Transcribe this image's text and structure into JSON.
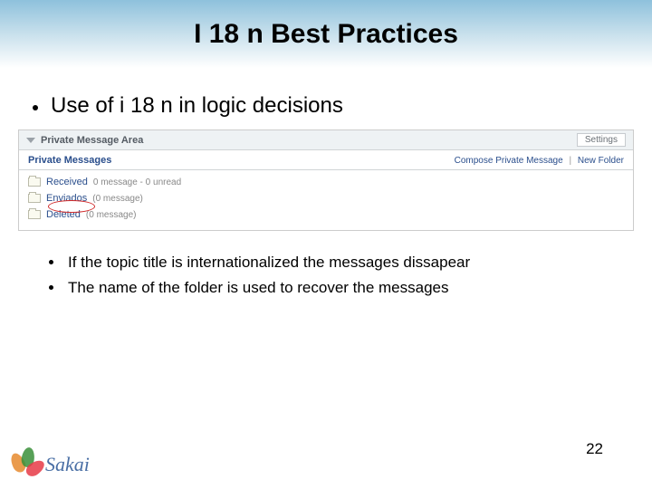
{
  "slide": {
    "title": "I 18 n Best Practices",
    "main_bullet": "Use of i 18 n in logic decisions",
    "sub_bullets": [
      "If the topic title is internationalized the messages dissapear",
      "The name of the folder is used to recover the messages"
    ],
    "page_number": "22"
  },
  "panel": {
    "area_title": "Private Message Area",
    "settings_label": "Settings",
    "section_title": "Private Messages",
    "compose_label": "Compose Private Message",
    "new_folder_label": "New Folder",
    "folders": [
      {
        "name": "Received",
        "meta": "0 message - 0 unread"
      },
      {
        "name": "Enviados",
        "meta": "(0 message)"
      },
      {
        "name": "Deleted",
        "meta": "(0 message)"
      }
    ]
  },
  "logo": {
    "text": "Sakai"
  }
}
